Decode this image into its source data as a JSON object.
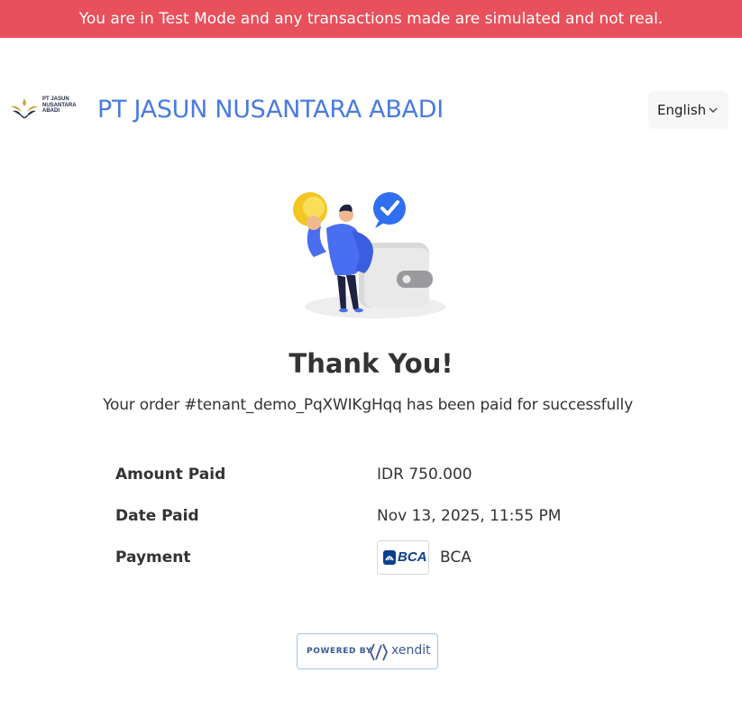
{
  "banner": {
    "text": "You are in Test Mode and any transactions made are simulated and not real.",
    "color": "#e8505b"
  },
  "header": {
    "logo_text": [
      "PT JASUN",
      "NUSANTARA",
      "ABADI"
    ],
    "merchant_name": "PT JASUN NUSANTARA ABADI",
    "merchant_color": "#4a7be0",
    "language": {
      "selected": "English",
      "icon": "chevron-down-icon"
    }
  },
  "illustration": {
    "icon": "payment-success-illustration"
  },
  "result": {
    "title": "Thank You!",
    "message": "Your order #tenant_demo_PqXWIKgHqq has been paid for successfully"
  },
  "details": {
    "amount_label": "Amount Paid",
    "amount_value": "IDR 750.000",
    "date_label": "Date Paid",
    "date_value": "Nov 13, 2025, 11:55 PM",
    "payment_label": "Payment",
    "payment_logo_text": "BCA",
    "payment_value": "BCA"
  },
  "footer": {
    "powered_by": "POWERED BY",
    "provider": "xendit",
    "icon": "xendit-logo-icon"
  }
}
